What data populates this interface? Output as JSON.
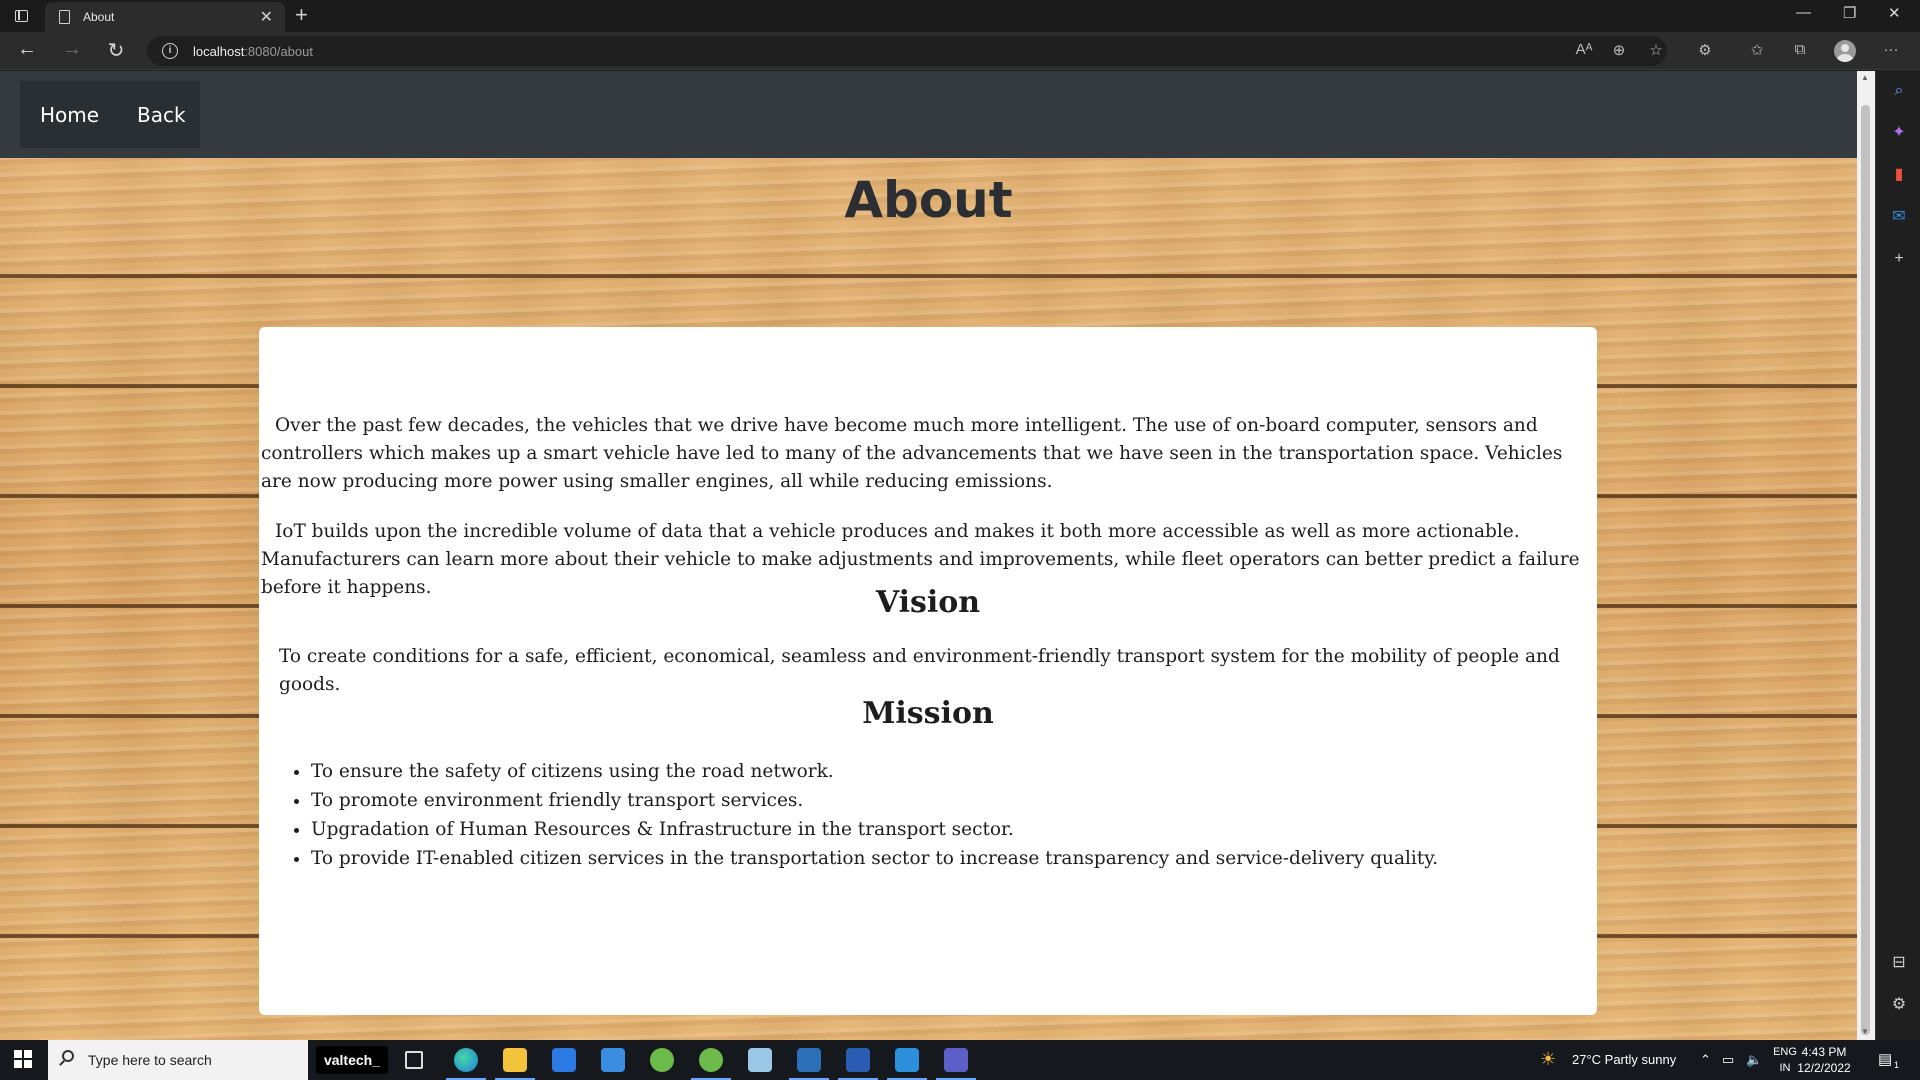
{
  "browser": {
    "tab_title": "About",
    "url_host": "localhost",
    "url_path": ":8080/about"
  },
  "site_nav": {
    "home_label": "Home",
    "back_label": "Back"
  },
  "page": {
    "title": "About",
    "paragraph_1": "Over the past few decades, the vehicles that we drive have become much more intelligent. The use of on-board computer, sensors and controllers which makes up a smart vehicle have led to many of the advancements that we have seen in the transportation space. Vehicles are now producing more power using smaller engines, all while reducing emissions.",
    "paragraph_2": "IoT builds upon the incredible volume of data that a vehicle produces and makes it both more accessible as well as more actionable. Manufacturers can learn more about their vehicle to make adjustments and improvements, while fleet operators can better predict a failure before it happens.",
    "vision_heading": "Vision",
    "vision_text": "To create conditions for a safe, efficient, economical, seamless and environment-friendly transport system for the mobility of people and goods.",
    "mission_heading": "Mission",
    "mission_items": [
      "To ensure the safety of citizens using the road network.",
      "To promote environment friendly transport services.",
      "Upgradation of Human Resources & Infrastructure in the transport sector.",
      "To provide IT-enabled citizen services in the transportation sector to increase transparency and service-delivery quality."
    ]
  },
  "taskbar": {
    "search_placeholder": "Type here to search",
    "pinned_label": "valtech_",
    "weather": "27°C  Partly sunny",
    "lang_top": "ENG",
    "lang_bottom": "IN",
    "time": "4:43 PM",
    "date": "12/2/2022",
    "notification_count": "1"
  },
  "colors": {
    "nav_bg": "#343a40",
    "title_color": "#2b2e33",
    "card_bg": "#ffffff"
  }
}
